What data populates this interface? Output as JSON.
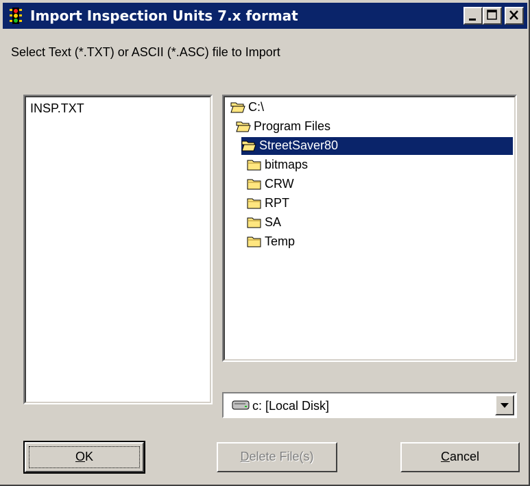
{
  "window": {
    "title": "Import Inspection Units 7.x format",
    "controls": [
      "minimize",
      "maximize",
      "close"
    ]
  },
  "prompt": "Select Text (*.TXT) or ASCII (*.ASC) file to Import",
  "file_list": {
    "items": [
      "INSP.TXT"
    ]
  },
  "directory_tree": {
    "items": [
      {
        "label": "C:\\",
        "icon": "open-folder-icon",
        "level": 0,
        "selected": false
      },
      {
        "label": "Program Files",
        "icon": "open-folder-icon",
        "level": 1,
        "selected": false
      },
      {
        "label": "StreetSaver80",
        "icon": "open-folder-icon",
        "level": 2,
        "selected": true
      },
      {
        "label": "bitmaps",
        "icon": "folder-icon",
        "level": 3,
        "selected": false
      },
      {
        "label": "CRW",
        "icon": "folder-icon",
        "level": 3,
        "selected": false
      },
      {
        "label": "RPT",
        "icon": "folder-icon",
        "level": 3,
        "selected": false
      },
      {
        "label": "SA",
        "icon": "folder-icon",
        "level": 3,
        "selected": false
      },
      {
        "label": "Temp",
        "icon": "folder-icon",
        "level": 3,
        "selected": false
      }
    ]
  },
  "drive_select": {
    "value": "c: [Local Disk]",
    "icon": "drive-icon"
  },
  "buttons": {
    "ok": {
      "prefix": "",
      "accel": "O",
      "suffix": "K"
    },
    "delete": {
      "prefix": "",
      "accel": "D",
      "suffix": "elete File(s)"
    },
    "cancel": {
      "prefix": "",
      "accel": "C",
      "suffix": "ancel"
    }
  },
  "colors": {
    "titlebar": "#0a246a",
    "selection": "#0a246a",
    "face": "#d4d0c8",
    "folder": "#ffe680"
  }
}
